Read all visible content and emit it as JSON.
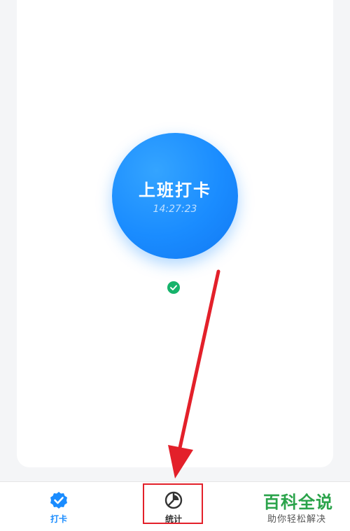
{
  "punch": {
    "title": "上班打卡",
    "time": "14:27:23",
    "button_color": "#1a8cff",
    "status_icon": "check-circle-icon",
    "status_color": "#16b36b"
  },
  "tabbar": {
    "items": [
      {
        "label": "打卡",
        "icon": "check-badge-icon",
        "active": true
      },
      {
        "label": "统计",
        "icon": "pie-chart-icon",
        "active": false
      }
    ]
  },
  "annotation": {
    "color": "#e3202a"
  },
  "watermark": {
    "main": "百科全说",
    "sub": "助你轻松解决",
    "color": "#2aa34a"
  }
}
